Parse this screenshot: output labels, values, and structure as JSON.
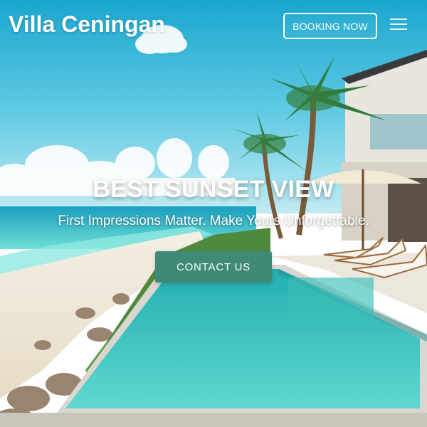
{
  "header": {
    "brand": "Villa Ceningan",
    "booking_label": "BOOKING NOW"
  },
  "hero": {
    "headline": "BEST SUNSET VIEW",
    "subline": "First Impressions Matter. Make Yours Unforgettable.",
    "cta_label": "CONTACT US"
  },
  "icons": {
    "menu": "hamburger-menu-icon"
  },
  "colors": {
    "cta_background": "#3e8a76",
    "text": "#ffffff",
    "sky": "#4fc1dd",
    "sea": "#2ec6c6",
    "pool": "#3cc8c0"
  }
}
